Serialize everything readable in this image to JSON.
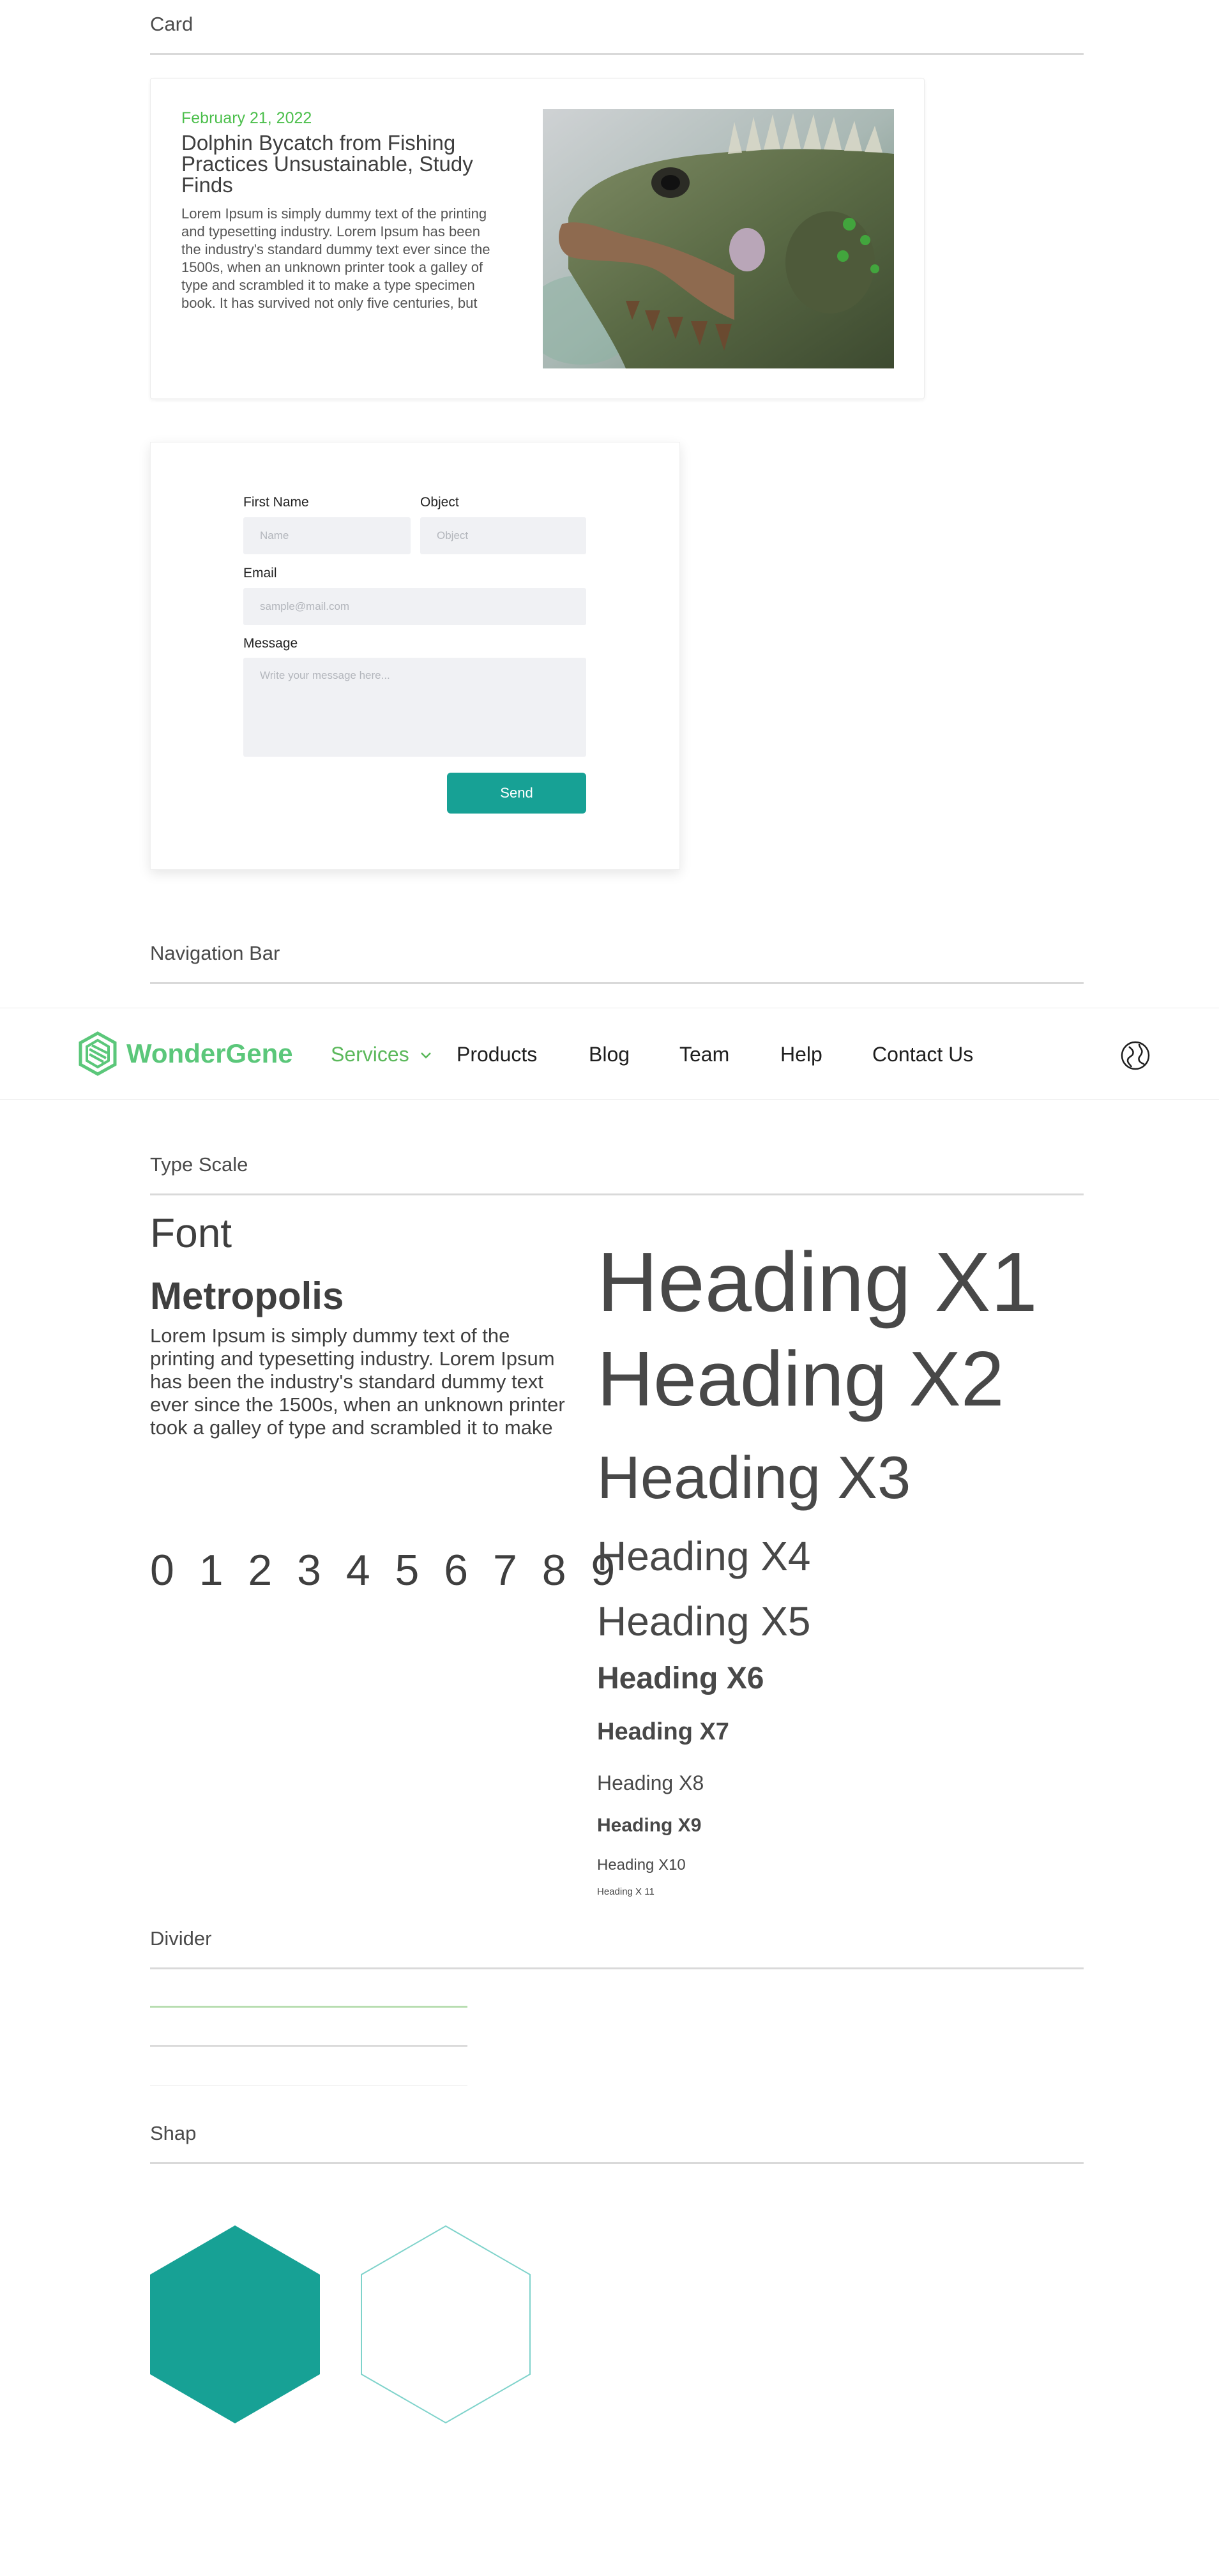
{
  "sections": {
    "card": "Card",
    "navigation_bar": "Navigation Bar",
    "type_scale": "Type Scale",
    "divider": "Divider",
    "shape": "Shap"
  },
  "card": {
    "date": "February 21, 2022",
    "title": "Dolphin Bycatch from Fishing Practices Unsustainable, Study Finds",
    "body": "Lorem Ipsum is simply dummy text of the printing and typesetting industry. Lorem Ipsum has been the industry's standard dummy text ever since the 1500s, when an unknown printer took a galley of type and scrambled it to make a type specimen book. It has survived not only five centuries, but also the leap into"
  },
  "form": {
    "first_name_label": "First Name",
    "first_name_placeholder": "Name",
    "object_label": "Object",
    "object_placeholder": "Object",
    "email_label": "Email",
    "email_placeholder": "sample@mail.com",
    "message_label": "Message",
    "message_placeholder": "Write your message here...",
    "send_label": "Send"
  },
  "navbar": {
    "brand": "WonderGene",
    "items": [
      "Services",
      "Products",
      "Blog",
      "Team",
      "Help",
      "Contact Us"
    ],
    "active_index": 0
  },
  "typography": {
    "font_word": "Font",
    "font_name": "Metropolis",
    "sample": "Lorem Ipsum is simply dummy text of the printing and typesetting industry. Lorem Ipsum has been the industry's standard dummy text ever since the 1500s, when an unknown printer took a galley of type and scrambled it to make a type specimen book. It has survived not only five centuries,",
    "digits": "0 1 2 3 4 5 6 7 8 9",
    "headings": [
      "Heading X1",
      "Heading X2",
      "Heading X3",
      "Heading X4",
      "Heading X5",
      "Heading X6",
      "Heading X7",
      "Heading X8",
      "Heading X9",
      "Heading X10",
      "Heading X 11"
    ]
  },
  "colors": {
    "accent_green": "#5bc77a",
    "teal": "#17a195",
    "teal_outline": "#7fd3cb",
    "text_dark": "#484848",
    "field_bg": "#f0f1f4",
    "divider_green": "#b7ddb0",
    "divider_gray": "#cfcfcf",
    "divider_light": "#eeeeee"
  },
  "icons": {
    "logo": "hexagon-logo-icon",
    "dropdown": "chevron-down-icon",
    "language": "globe-icon"
  }
}
